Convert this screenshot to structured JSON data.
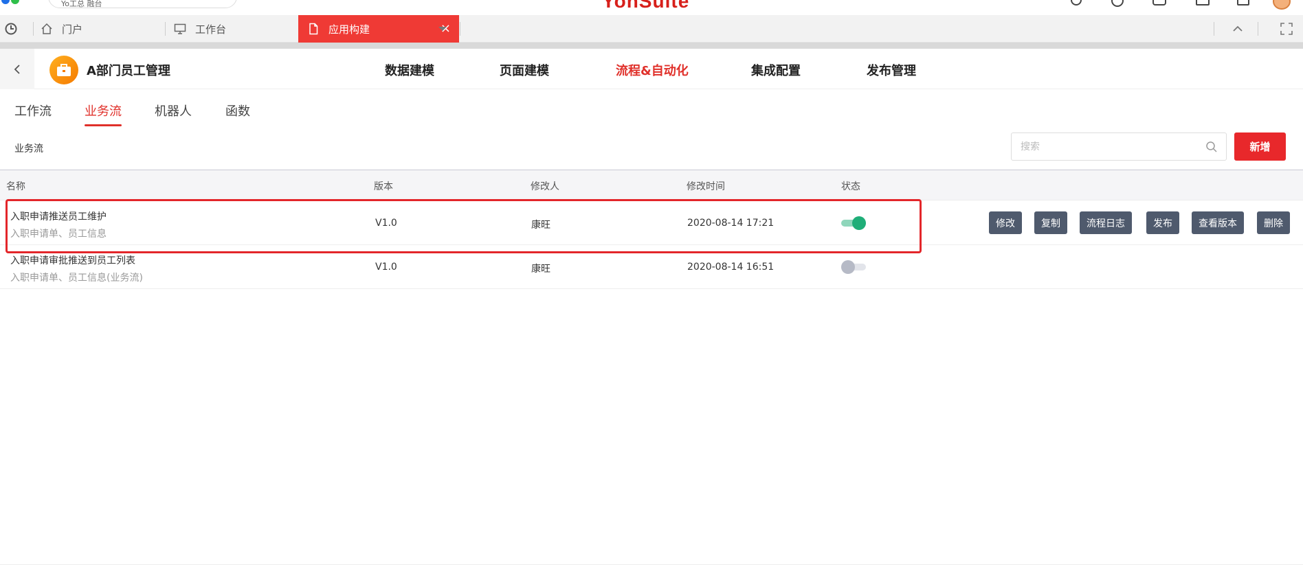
{
  "top": {
    "search_value": "Yo工总 融台",
    "brand": "YonSuite"
  },
  "tabs": [
    {
      "label": "门户"
    },
    {
      "label": "工作台"
    },
    {
      "label": "应用构建",
      "close": "×"
    }
  ],
  "app": {
    "name": "A部门员工管理",
    "nav": [
      "数据建模",
      "页面建模",
      "流程&自动化",
      "集成配置",
      "发布管理"
    ],
    "active_nav": "流程&自动化"
  },
  "sub_tabs": [
    "工作流",
    "业务流",
    "机器人",
    "函数"
  ],
  "active_sub_tab": "业务流",
  "section_title": "业务流",
  "search": {
    "placeholder": "搜索",
    "value": ""
  },
  "add_button": "新增",
  "table": {
    "headers": [
      "名称",
      "版本",
      "修改人",
      "修改时间",
      "状态"
    ],
    "rows": [
      {
        "name": "入职申请推送员工维护",
        "desc": "入职申请单、员工信息",
        "version": "V1.0",
        "modifier": "康旺",
        "time": "2020-08-14 17:21",
        "enabled": true
      },
      {
        "name": "入职申请审批推送到员工列表",
        "desc": "入职申请单、员工信息(业务流)",
        "version": "V1.0",
        "modifier": "康旺",
        "time": "2020-08-14 16:51",
        "enabled": false
      }
    ],
    "row_actions": [
      "修改",
      "复制",
      "流程日志",
      "发布",
      "查看版本",
      "删除"
    ]
  },
  "colors": {
    "accent": "#e8282b",
    "active_tab": "#ef3a35",
    "toggle_on": "#1fae78",
    "action_button": "#4f5a6d"
  }
}
